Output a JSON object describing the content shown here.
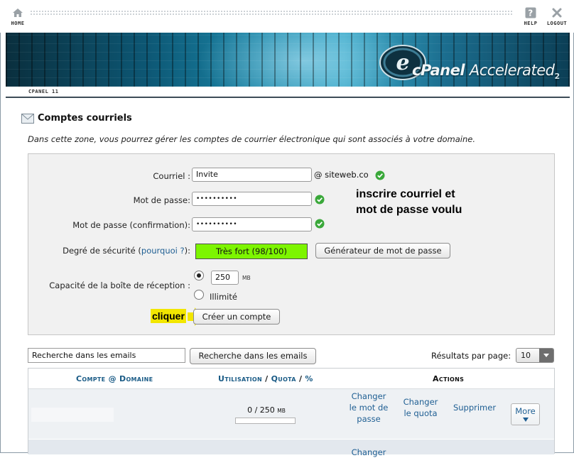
{
  "topbar": {
    "home_label": "HOME",
    "help_label": "HELP",
    "logout_label": "LOGOUT"
  },
  "banner": {
    "logo_c": "cPanel",
    "logo_accel": "Accelerated",
    "logo_version": "2"
  },
  "breadcrumb": "CPANEL 11",
  "page": {
    "title": "Comptes courriels",
    "description": "Dans cette zone, vous pourrez gérer les comptes de courrier électronique qui sont associés à votre domaine."
  },
  "form": {
    "email_label": "Courriel :",
    "email_value": "Invite",
    "domain": "@ siteweb.co",
    "password_label": "Mot de passe:",
    "password_value": "••••••••••",
    "confirm_label": "Mot de passe (confirmation):",
    "confirm_value": "••••••••••",
    "strength_label_prefix": "Degré de sécurité (",
    "strength_link": "pourquoi ?",
    "strength_label_suffix": "):",
    "strength_value": "Très fort (98/100)",
    "generator_button": "Générateur de mot de passe",
    "quota_label": "Capacité de la boîte de réception :",
    "quota_value": "250",
    "quota_unit": "MB",
    "unlimited_label": "Illimité",
    "create_button": "Créer un compte"
  },
  "annotations": {
    "instruction_line1": "inscrire courriel et",
    "instruction_line2": "mot de passe voulu",
    "click_label": "cliquer"
  },
  "search": {
    "input_value": "Recherche dans les emails",
    "button_label": "Recherche dans les emails",
    "results_label": "Résultats par page:",
    "results_value": "10"
  },
  "table": {
    "col_account": "Compte",
    "col_at": "@",
    "col_domain": "Domaine",
    "col_usage": "Utilisation",
    "col_sep1": "/",
    "col_quota": "Quota",
    "col_sep2": "/",
    "col_percent": "%",
    "col_actions": "Actions",
    "row": {
      "usage_text": "0 / 250",
      "usage_unit": "MB",
      "usage_fraction": 0,
      "change_password": [
        "Changer",
        "le mot de",
        "passe"
      ],
      "change_quota": [
        "Changer",
        "le quota"
      ],
      "delete": "Supprimer",
      "more": "More"
    },
    "row2_partial": "Changer"
  },
  "colors": {
    "strength_green": "#7df500",
    "link_blue": "#1f5f93",
    "annotation_arrow": "#f2e600"
  }
}
